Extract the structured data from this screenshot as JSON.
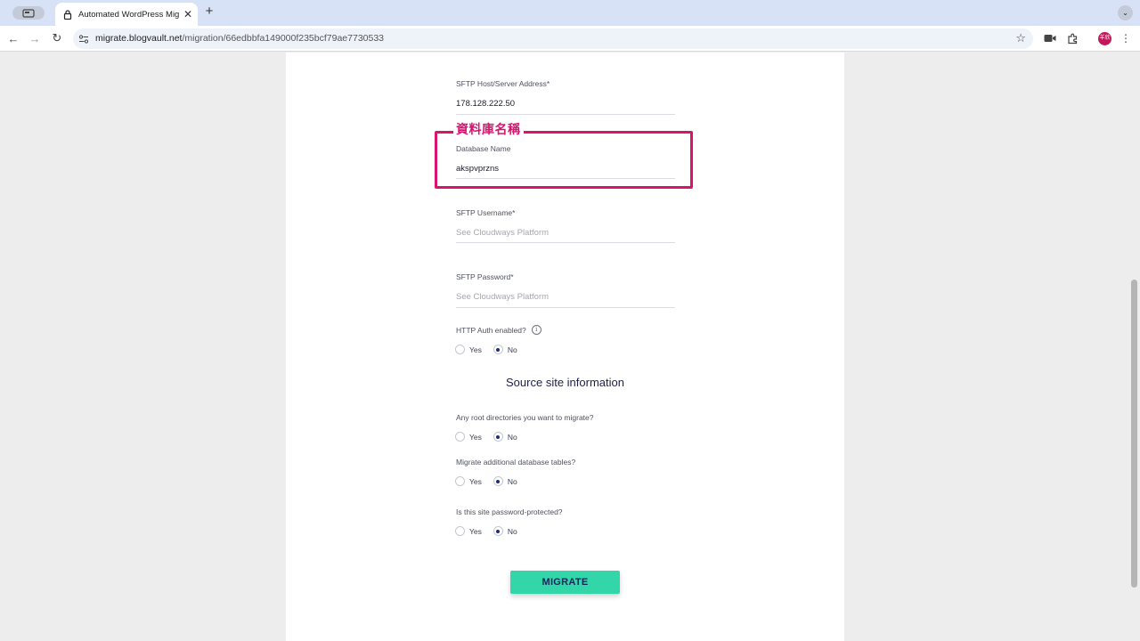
{
  "browser": {
    "tab_title": "Automated WordPress Migrat",
    "close_glyph": "✕",
    "new_tab_glyph": "+",
    "tab_menu_glyph": "⌄",
    "url_host": "migrate.blogvault.net",
    "url_path": "/migration/66edbbfa149000f235bcf79ae7730533",
    "back_glyph": "←",
    "forward_glyph": "→",
    "reload_glyph": "↻",
    "star_glyph": "☆",
    "avatar_text": "羊欣",
    "menu_glyph": "⋮"
  },
  "form": {
    "sftp_host": {
      "label": "SFTP Host/Server Address*",
      "value": "178.128.222.50"
    },
    "annotation_label": "資料庫名稱",
    "db_name": {
      "label": "Database Name",
      "value": "akspvprzns"
    },
    "sftp_username": {
      "label": "SFTP Username*",
      "placeholder": "See Cloudways Platform"
    },
    "sftp_password": {
      "label": "SFTP Password*",
      "placeholder": "See Cloudways Platform"
    },
    "http_auth": {
      "label": "HTTP Auth enabled?",
      "info_glyph": "i",
      "yes": "Yes",
      "no": "No",
      "selected": "No"
    },
    "section_title": "Source site information",
    "root_dirs": {
      "label": "Any root directories you want to migrate?",
      "yes": "Yes",
      "no": "No",
      "selected": "No"
    },
    "db_tables": {
      "label": "Migrate additional database tables?",
      "yes": "Yes",
      "no": "No",
      "selected": "No"
    },
    "password_protected": {
      "label": "Is this site password-protected?",
      "yes": "Yes",
      "no": "No",
      "selected": "No"
    },
    "migrate_button": "MIGRATE"
  },
  "colors": {
    "accent_button": "#33d6a9",
    "highlight": "#d9136e",
    "radio_selected": "#1f2b84"
  }
}
